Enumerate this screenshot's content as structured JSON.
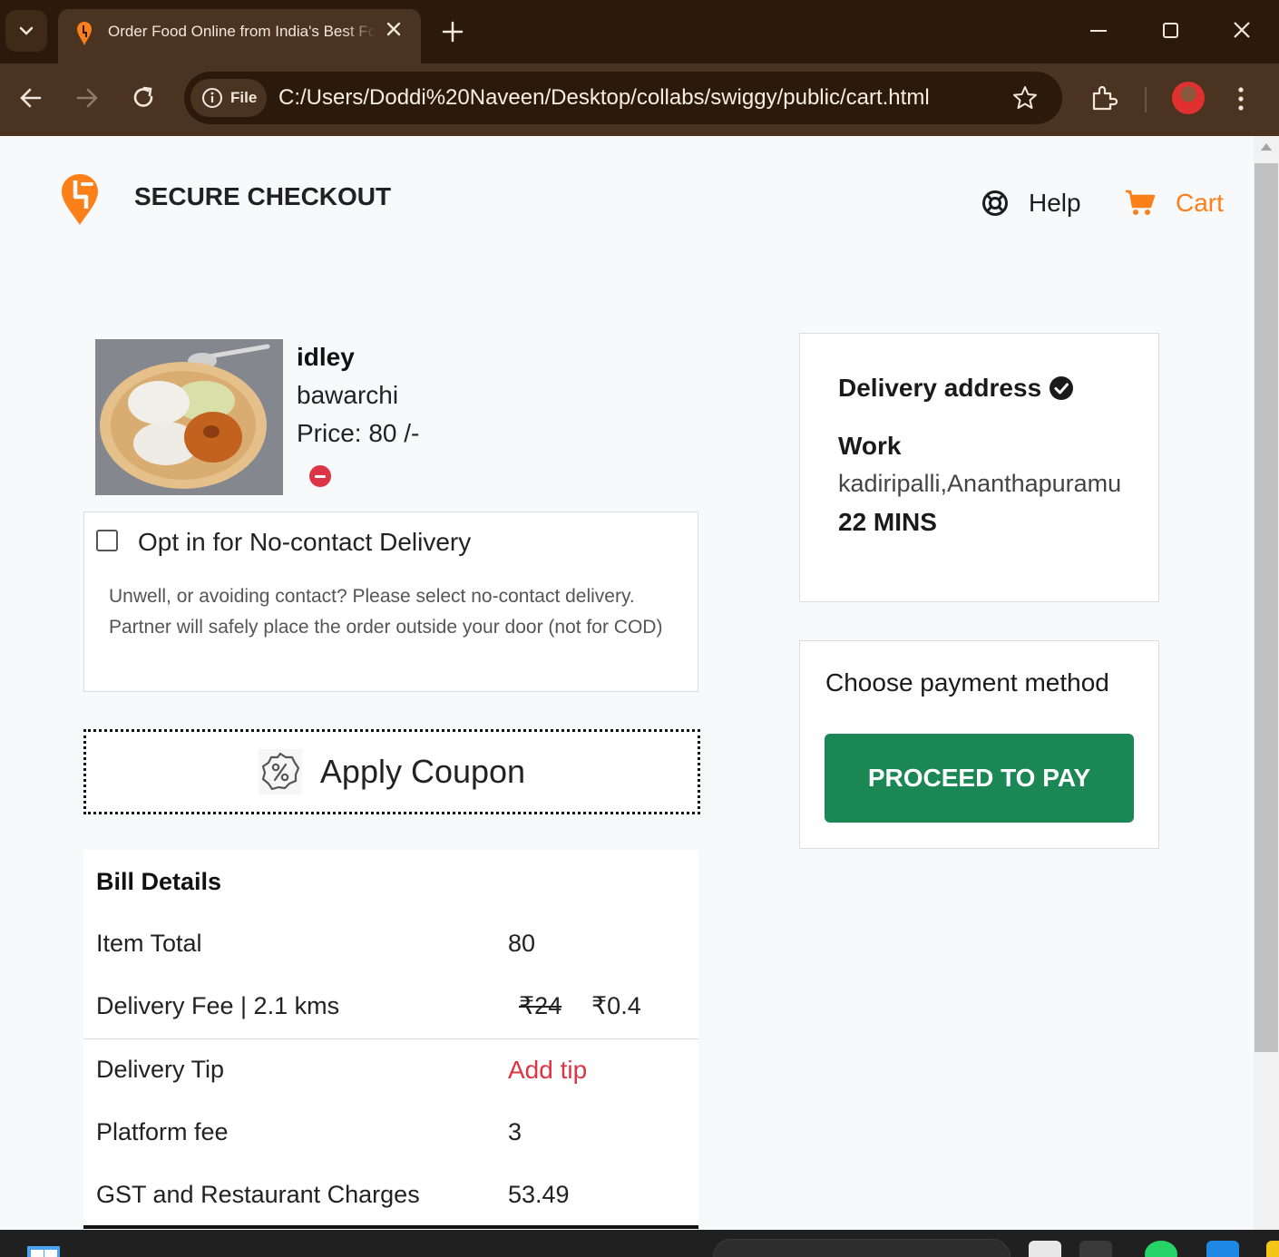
{
  "browser": {
    "tab_title": "Order Food Online from India's Best Food Delivery Service | Swiggy",
    "site_chip_label": "File",
    "url": "C:/Users/Doddi%20Naveen/Desktop/collabs/swiggy/public/cart.html",
    "icons": [
      "tab-search-icon",
      "swiggy-favicon",
      "close-icon",
      "plus-icon",
      "minimize-icon",
      "maximize-icon",
      "close-window-icon",
      "back-icon",
      "forward-icon",
      "reload-icon",
      "info-icon",
      "star-icon",
      "extensions-icon",
      "profile-avatar",
      "more-menu-icon"
    ]
  },
  "header": {
    "title": "SECURE CHECKOUT",
    "help_label": "Help",
    "cart_label": "Cart",
    "accent_color": "#fc8019"
  },
  "item": {
    "name": "idley",
    "restaurant": "bawarchi",
    "price": "Price: 80 /-"
  },
  "no_contact": {
    "title": "Opt in for No-contact Delivery",
    "description": "Unwell, or avoiding contact? Please select no-contact delivery. Partner will safely place the order outside your door (not for COD)",
    "checked": false
  },
  "coupon": {
    "label": "Apply Coupon"
  },
  "bill": {
    "title": "Bill Details",
    "item_total_label": "Item Total",
    "item_total_value": "80",
    "delivery_fee_label": "Delivery Fee | 2.1 kms",
    "delivery_fee_original": "₹24",
    "delivery_fee_value": "₹0.4",
    "delivery_tip_label": "Delivery Tip",
    "delivery_tip_action": "Add tip",
    "platform_fee_label": "Platform fee",
    "platform_fee_value": "3",
    "gst_label": "GST and Restaurant Charges",
    "gst_value": "53.49"
  },
  "address": {
    "title": "Delivery address",
    "type": "Work",
    "line": "kadiripalli,Ananthapuramu",
    "eta": "22 MINS"
  },
  "payment": {
    "title": "Choose payment method",
    "button_label": "PROCEED TO PAY",
    "button_color": "#1b8754"
  }
}
